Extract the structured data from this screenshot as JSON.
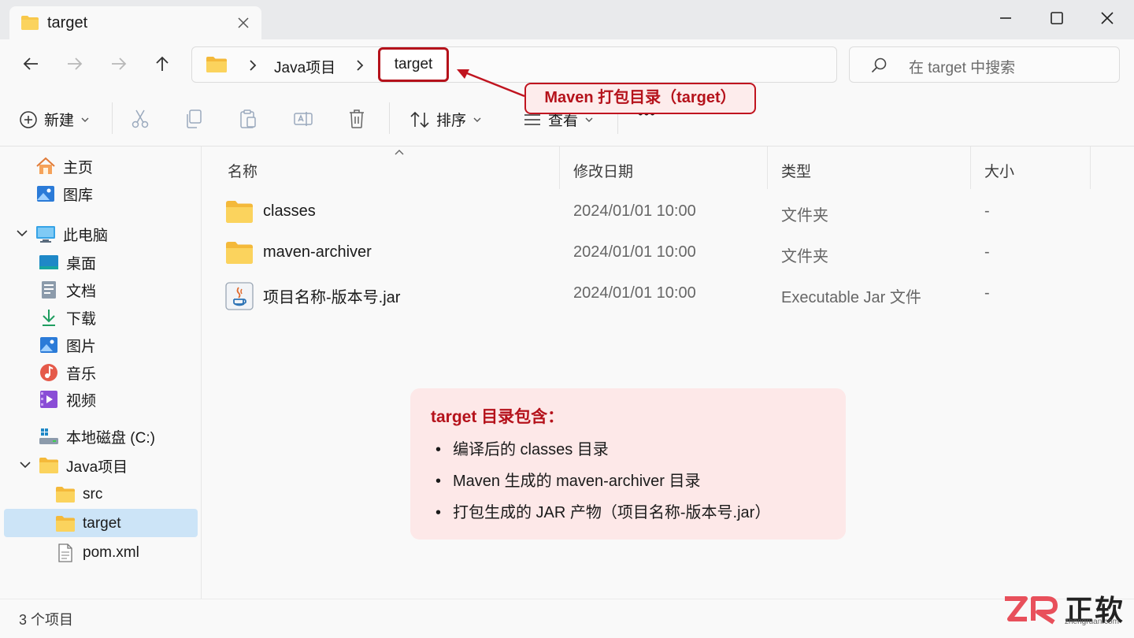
{
  "tab": {
    "title": "target",
    "close_label": "×"
  },
  "window_controls": {
    "minimize": "minimize",
    "maximize": "maximize",
    "close": "close"
  },
  "nav": {
    "breadcrumb": [
      "Java项目",
      "target"
    ],
    "search_placeholder": "在 target 中搜索"
  },
  "callout": {
    "text": "Maven 打包目录（target）"
  },
  "commands": {
    "new_label": "新建",
    "sort_label": "排序",
    "view_label": "查看",
    "more_label": "•••"
  },
  "sidebar": {
    "quick": [
      {
        "label": "主页",
        "icon": "home-icon"
      },
      {
        "label": "图库",
        "icon": "gallery-icon"
      }
    ],
    "this_pc": {
      "label": "此电脑",
      "icon": "pc-icon"
    },
    "pc_items": [
      {
        "label": "桌面",
        "icon": "desktop-icon"
      },
      {
        "label": "文档",
        "icon": "documents-icon"
      },
      {
        "label": "下载",
        "icon": "download-icon"
      },
      {
        "label": "图片",
        "icon": "pictures-icon"
      },
      {
        "label": "音乐",
        "icon": "music-icon"
      },
      {
        "label": "视频",
        "icon": "videos-icon"
      }
    ],
    "drive": {
      "label": "本地磁盘 (C:)",
      "icon": "drive-icon"
    },
    "java_project": {
      "label": "Java项目",
      "icon": "folder-icon"
    },
    "project_items": [
      {
        "label": "src",
        "icon": "folder-icon"
      },
      {
        "label": "target",
        "icon": "folder-icon",
        "selected": true
      },
      {
        "label": "pom.xml",
        "icon": "file-icon"
      }
    ]
  },
  "columns": {
    "name": "名称",
    "modified": "修改日期",
    "type": "类型",
    "size": "大小"
  },
  "files": [
    {
      "name": "classes",
      "modified": "2024/01/01 10:00",
      "type": "文件夹",
      "size": "-",
      "icon": "folder-icon"
    },
    {
      "name": "maven-archiver",
      "modified": "2024/01/01 10:00",
      "type": "文件夹",
      "size": "-",
      "icon": "folder-icon"
    },
    {
      "name": "项目名称-版本号.jar",
      "modified": "2024/01/01 10:00",
      "type": "Executable Jar 文件",
      "size": "-",
      "icon": "jar-icon"
    }
  ],
  "info_box": {
    "heading": "target 目录包含：",
    "items": [
      "编译后的 classes 目录",
      "Maven 生成的 maven-archiver 目录",
      "打包生成的 JAR 产物（项目名称-版本号.jar）"
    ]
  },
  "status": {
    "count_text": "3 个项目"
  },
  "watermark": {
    "brand": "正软",
    "url": "zhengruan.com"
  },
  "colors": {
    "accent_red": "#b5121b",
    "selection": "#cce4f7",
    "folder": "#f8c84a"
  }
}
